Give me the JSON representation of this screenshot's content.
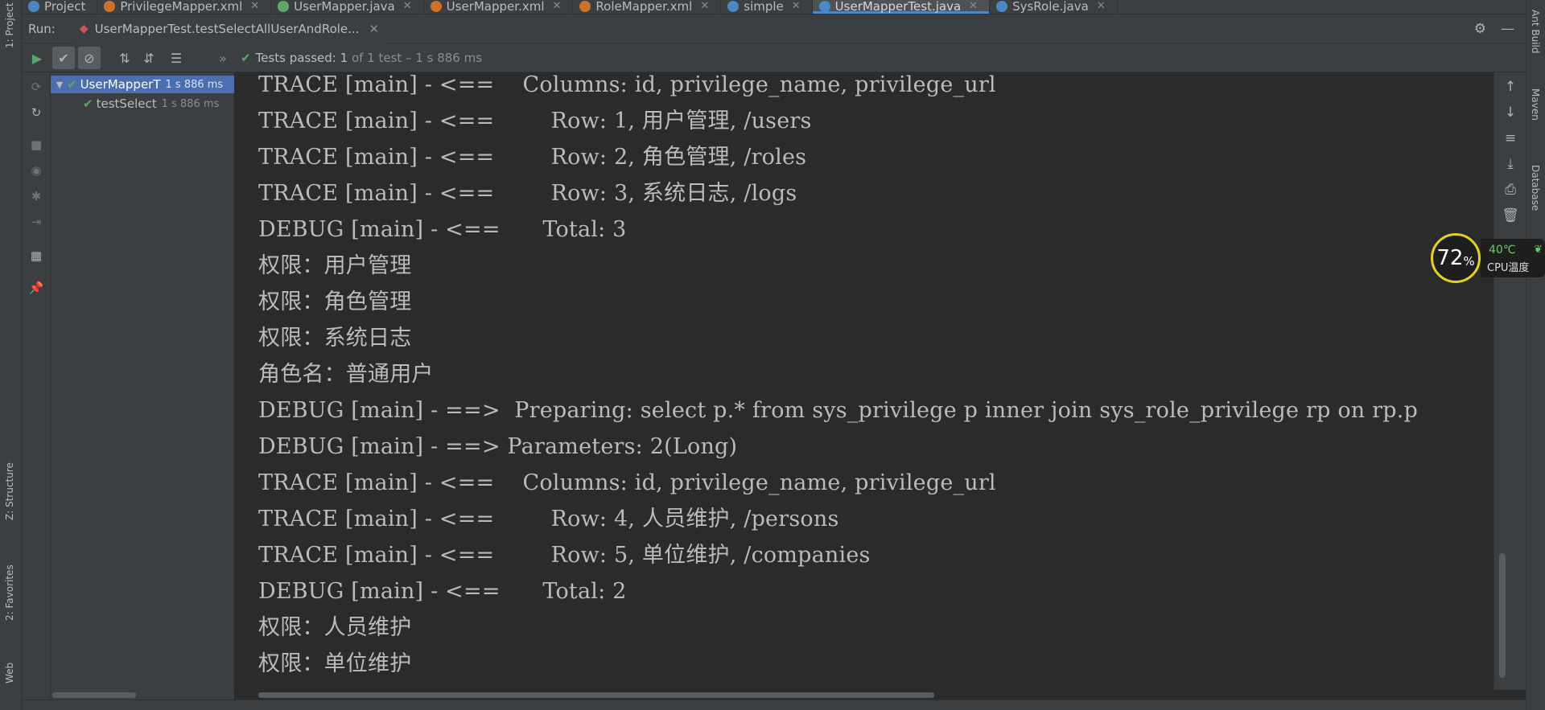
{
  "left_strip": {
    "project_tab": "1: Project",
    "structure_tab": "Z: Structure",
    "favorites_tab": "2: Favorites",
    "web_tab": "Web"
  },
  "right_strip": {
    "ant_tab": "Ant Build",
    "maven_tab": "Maven",
    "database_tab": "Database"
  },
  "editor_tabs": [
    {
      "label": "Project",
      "icon": "project-icon",
      "color": "#4a88c7"
    },
    {
      "label": "PrivilegeMapper.xml",
      "icon": "xml-file-icon",
      "color": "#d0702a"
    },
    {
      "label": "UserMapper.java",
      "icon": "interface-icon",
      "color": "#59a869"
    },
    {
      "label": "UserMapper.xml",
      "icon": "xml-file-icon",
      "color": "#d0702a"
    },
    {
      "label": "RoleMapper.xml",
      "icon": "xml-file-icon",
      "color": "#d0702a"
    },
    {
      "label": "simple",
      "icon": "maven-icon",
      "color": "#4a88c7"
    },
    {
      "label": "UserMapperTest.java",
      "icon": "class-icon",
      "color": "#4a88c7"
    },
    {
      "label": "SysRole.java",
      "icon": "class-icon",
      "color": "#4a88c7"
    }
  ],
  "run": {
    "label": "Run:",
    "config_tab": "UserMapperTest.testSelectAllUserAndRole..."
  },
  "test_status": {
    "passed_text": "Tests passed: 1",
    "detail_text": " of 1 test – 1 s 886 ms"
  },
  "test_tree": [
    {
      "name": "UserMapperT",
      "time": "1 s 886 ms",
      "selected": true
    },
    {
      "name": "testSelect",
      "time": "1 s 886 ms",
      "selected": false
    }
  ],
  "console_lines": [
    "TRACE [main] - <==    Columns: id, privilege_name, privilege_url",
    "TRACE [main] - <==        Row: 1, 用户管理, /users",
    "TRACE [main] - <==        Row: 2, 角色管理, /roles",
    "TRACE [main] - <==        Row: 3, 系统日志, /logs",
    "DEBUG [main] - <==      Total: 3",
    "权限：用户管理",
    "权限：角色管理",
    "权限：系统日志",
    "角色名：普通用户",
    "DEBUG [main] - ==>  Preparing: select p.* from sys_privilege p inner join sys_role_privilege rp on rp.p",
    "DEBUG [main] - ==> Parameters: 2(Long)",
    "TRACE [main] - <==    Columns: id, privilege_name, privilege_url",
    "TRACE [main] - <==        Row: 4, 人员维护, /persons",
    "TRACE [main] - <==        Row: 5, 单位维护, /companies",
    "DEBUG [main] - <==      Total: 2",
    "权限：人员维护",
    "权限：单位维护"
  ],
  "cpu_widget": {
    "percent": "72",
    "percent_sign": "%",
    "temp": "40℃",
    "label": "CPU温度",
    "ring_color": "#e5d21a",
    "temp_color": "#5fd35f"
  },
  "colors": {
    "pass_green": "#59a869",
    "selection_blue": "#4b6eaf",
    "console_bg": "#2b2b2b",
    "panel_bg": "#3c3f41"
  }
}
